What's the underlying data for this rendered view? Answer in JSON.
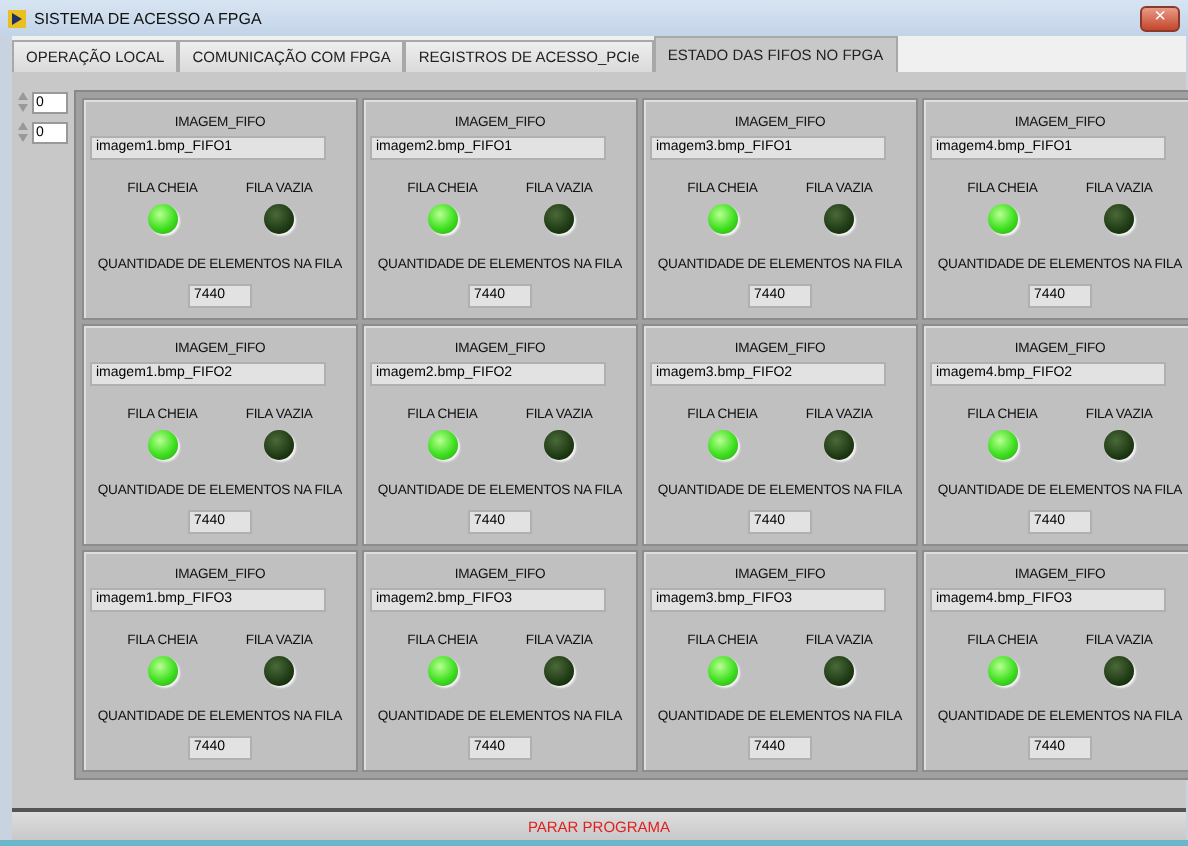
{
  "window": {
    "title": "SISTEMA DE ACESSO A FPGA",
    "close": "×"
  },
  "tabs": [
    {
      "label": "OPERAÇÃO LOCAL",
      "selected": false
    },
    {
      "label": "COMUNICAÇÃO COM FPGA",
      "selected": false
    },
    {
      "label": "REGISTROS DE ACESSO_PCIe",
      "selected": false
    },
    {
      "label": "ESTADO DAS FIFOS NO FPGA",
      "selected": true
    }
  ],
  "index_controls": [
    {
      "value": "0"
    },
    {
      "value": "0"
    }
  ],
  "fifos": [
    {
      "title": "IMAGEM_FIFO",
      "name": "imagem1.bmp_FIFO1",
      "full_label": "FILA CHEIA",
      "full_on": true,
      "empty_label": "FILA VAZIA",
      "empty_on": false,
      "count_label": "QUANTIDADE DE ELEMENTOS NA FILA",
      "count": "7440"
    },
    {
      "title": "IMAGEM_FIFO",
      "name": "imagem2.bmp_FIFO1",
      "full_label": "FILA CHEIA",
      "full_on": true,
      "empty_label": "FILA VAZIA",
      "empty_on": false,
      "count_label": "QUANTIDADE DE ELEMENTOS NA FILA",
      "count": "7440"
    },
    {
      "title": "IMAGEM_FIFO",
      "name": "imagem3.bmp_FIFO1",
      "full_label": "FILA CHEIA",
      "full_on": true,
      "empty_label": "FILA VAZIA",
      "empty_on": false,
      "count_label": "QUANTIDADE DE ELEMENTOS NA FILA",
      "count": "7440"
    },
    {
      "title": "IMAGEM_FIFO",
      "name": "imagem4.bmp_FIFO1",
      "full_label": "FILA CHEIA",
      "full_on": true,
      "empty_label": "FILA VAZIA",
      "empty_on": false,
      "count_label": "QUANTIDADE DE ELEMENTOS NA FILA",
      "count": "7440"
    },
    {
      "title": "IMAGEM_FIFO",
      "name": "imagem1.bmp_FIFO2",
      "full_label": "FILA CHEIA",
      "full_on": true,
      "empty_label": "FILA VAZIA",
      "empty_on": false,
      "count_label": "QUANTIDADE DE ELEMENTOS NA FILA",
      "count": "7440"
    },
    {
      "title": "IMAGEM_FIFO",
      "name": "imagem2.bmp_FIFO2",
      "full_label": "FILA CHEIA",
      "full_on": true,
      "empty_label": "FILA VAZIA",
      "empty_on": false,
      "count_label": "QUANTIDADE DE ELEMENTOS NA FILA",
      "count": "7440"
    },
    {
      "title": "IMAGEM_FIFO",
      "name": "imagem3.bmp_FIFO2",
      "full_label": "FILA CHEIA",
      "full_on": true,
      "empty_label": "FILA VAZIA",
      "empty_on": false,
      "count_label": "QUANTIDADE DE ELEMENTOS NA FILA",
      "count": "7440"
    },
    {
      "title": "IMAGEM_FIFO",
      "name": "imagem4.bmp_FIFO2",
      "full_label": "FILA CHEIA",
      "full_on": true,
      "empty_label": "FILA VAZIA",
      "empty_on": false,
      "count_label": "QUANTIDADE DE ELEMENTOS NA FILA",
      "count": "7440"
    },
    {
      "title": "IMAGEM_FIFO",
      "name": "imagem1.bmp_FIFO3",
      "full_label": "FILA CHEIA",
      "full_on": true,
      "empty_label": "FILA VAZIA",
      "empty_on": false,
      "count_label": "QUANTIDADE DE ELEMENTOS NA FILA",
      "count": "7440"
    },
    {
      "title": "IMAGEM_FIFO",
      "name": "imagem2.bmp_FIFO3",
      "full_label": "FILA CHEIA",
      "full_on": true,
      "empty_label": "FILA VAZIA",
      "empty_on": false,
      "count_label": "QUANTIDADE DE ELEMENTOS NA FILA",
      "count": "7440"
    },
    {
      "title": "IMAGEM_FIFO",
      "name": "imagem3.bmp_FIFO3",
      "full_label": "FILA CHEIA",
      "full_on": true,
      "empty_label": "FILA VAZIA",
      "empty_on": false,
      "count_label": "QUANTIDADE DE ELEMENTOS NA FILA",
      "count": "7440"
    },
    {
      "title": "IMAGEM_FIFO",
      "name": "imagem4.bmp_FIFO3",
      "full_label": "FILA CHEIA",
      "full_on": true,
      "empty_label": "FILA VAZIA",
      "empty_on": false,
      "count_label": "QUANTIDADE DE ELEMENTOS NA FILA",
      "count": "7440"
    }
  ],
  "stop_button": {
    "label": "PARAR PROGRAMA"
  }
}
